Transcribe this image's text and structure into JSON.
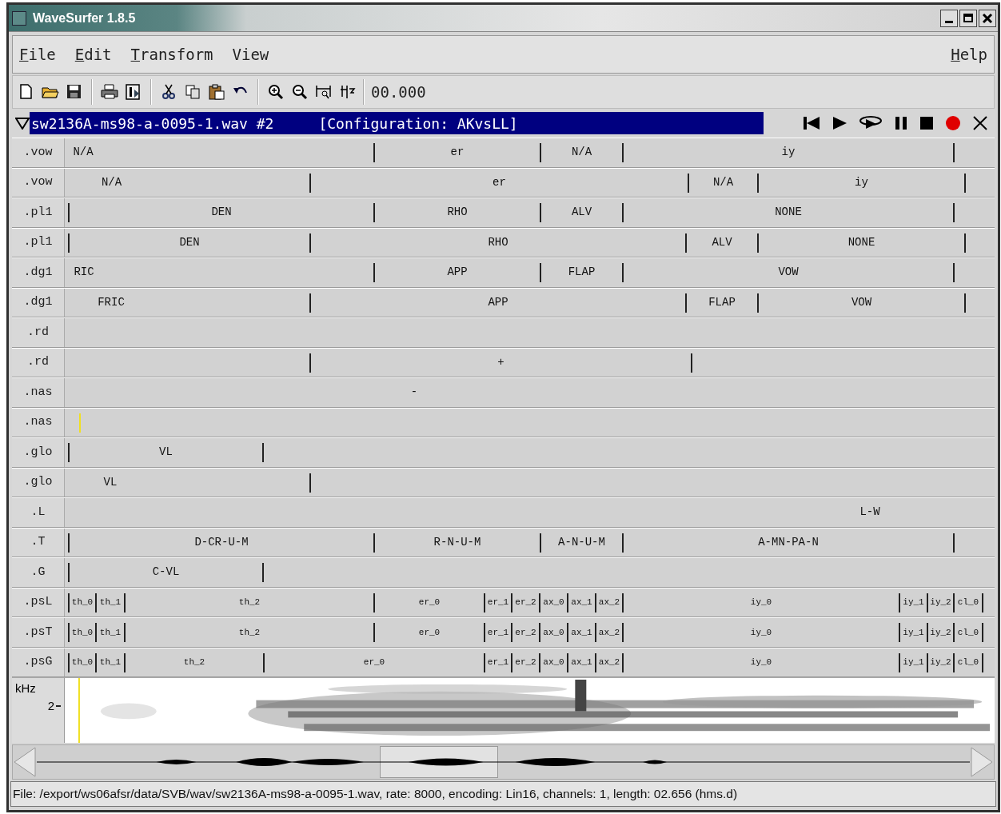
{
  "window": {
    "title": "WaveSurfer 1.8.5"
  },
  "menu": {
    "left": [
      {
        "label": "File",
        "mnemonic": true
      },
      {
        "label": "Edit",
        "mnemonic": true
      },
      {
        "label": "Transform",
        "mnemonic": true
      },
      {
        "label": "View",
        "mnemonic": false
      }
    ],
    "right": [
      {
        "label": "Help",
        "mnemonic": true
      }
    ]
  },
  "toolbar": {
    "time": "00.000"
  },
  "sound": {
    "expanded": true,
    "file": "sw2136A-ms98-a-0095-1.wav #2",
    "configuration": "[Configuration: AKvsLL]"
  },
  "tiers": [
    {
      "name": ".vow",
      "segments": [
        "N/A",
        "er",
        "N/A",
        "iy"
      ]
    },
    {
      "name": ".vow",
      "segments": [
        "N/A",
        "er",
        "N/A",
        "iy"
      ]
    },
    {
      "name": ".pl1",
      "segments": [
        "DEN",
        "RHO",
        "ALV",
        "NONE"
      ]
    },
    {
      "name": ".pl1",
      "segments": [
        "DEN",
        "RHO",
        "ALV",
        "NONE"
      ]
    },
    {
      "name": ".dg1",
      "segments": [
        "RIC",
        "APP",
        "FLAP",
        "VOW"
      ]
    },
    {
      "name": ".dg1",
      "segments": [
        "FRIC",
        "APP",
        "FLAP",
        "VOW"
      ]
    },
    {
      "name": ".rd"
    },
    {
      "name": ".rd",
      "segments": [
        "+"
      ]
    },
    {
      "name": ".nas",
      "segments": [
        "-"
      ]
    },
    {
      "name": ".nas"
    },
    {
      "name": ".glo",
      "segments": [
        "VL"
      ]
    },
    {
      "name": ".glo",
      "segments": [
        "VL"
      ]
    },
    {
      "name": ".L",
      "segments": [
        "L-W"
      ]
    },
    {
      "name": ".T",
      "segments": [
        "D-CR-U-M",
        "R-N-U-M",
        "A-N-U-M",
        "A-MN-PA-N"
      ]
    },
    {
      "name": ".G",
      "segments": [
        "C-VL"
      ]
    },
    {
      "name": ".psL",
      "segments": [
        "th_0",
        "th_1",
        "th_2",
        "er_0",
        "er_1",
        "er_2",
        "ax_0",
        "ax_1",
        "ax_2",
        "iy_0",
        "iy_1",
        "iy_2",
        "cl_0"
      ]
    },
    {
      "name": ".psT",
      "segments": [
        "th_0",
        "th_1",
        "th_2",
        "er_0",
        "er_1",
        "er_2",
        "ax_0",
        "ax_1",
        "ax_2",
        "iy_0",
        "iy_1",
        "iy_2",
        "cl_0"
      ]
    },
    {
      "name": ".psG",
      "segments": [
        "th_0",
        "th_1",
        "th_2",
        "er_0",
        "er_1",
        "er_2",
        "ax_0",
        "ax_1",
        "ax_2",
        "iy_0",
        "iy_1",
        "iy_2",
        "cl_0"
      ]
    }
  ],
  "spectrogram": {
    "unit": "kHz",
    "ticks": [
      "2"
    ]
  },
  "status_bar": "File: /export/ws06afsr/data/SVB/wav/sw2136A-ms98-a-0095-1.wav, rate: 8000, encoding: Lin16, channels: 1, length: 02.656 (hms.d)"
}
